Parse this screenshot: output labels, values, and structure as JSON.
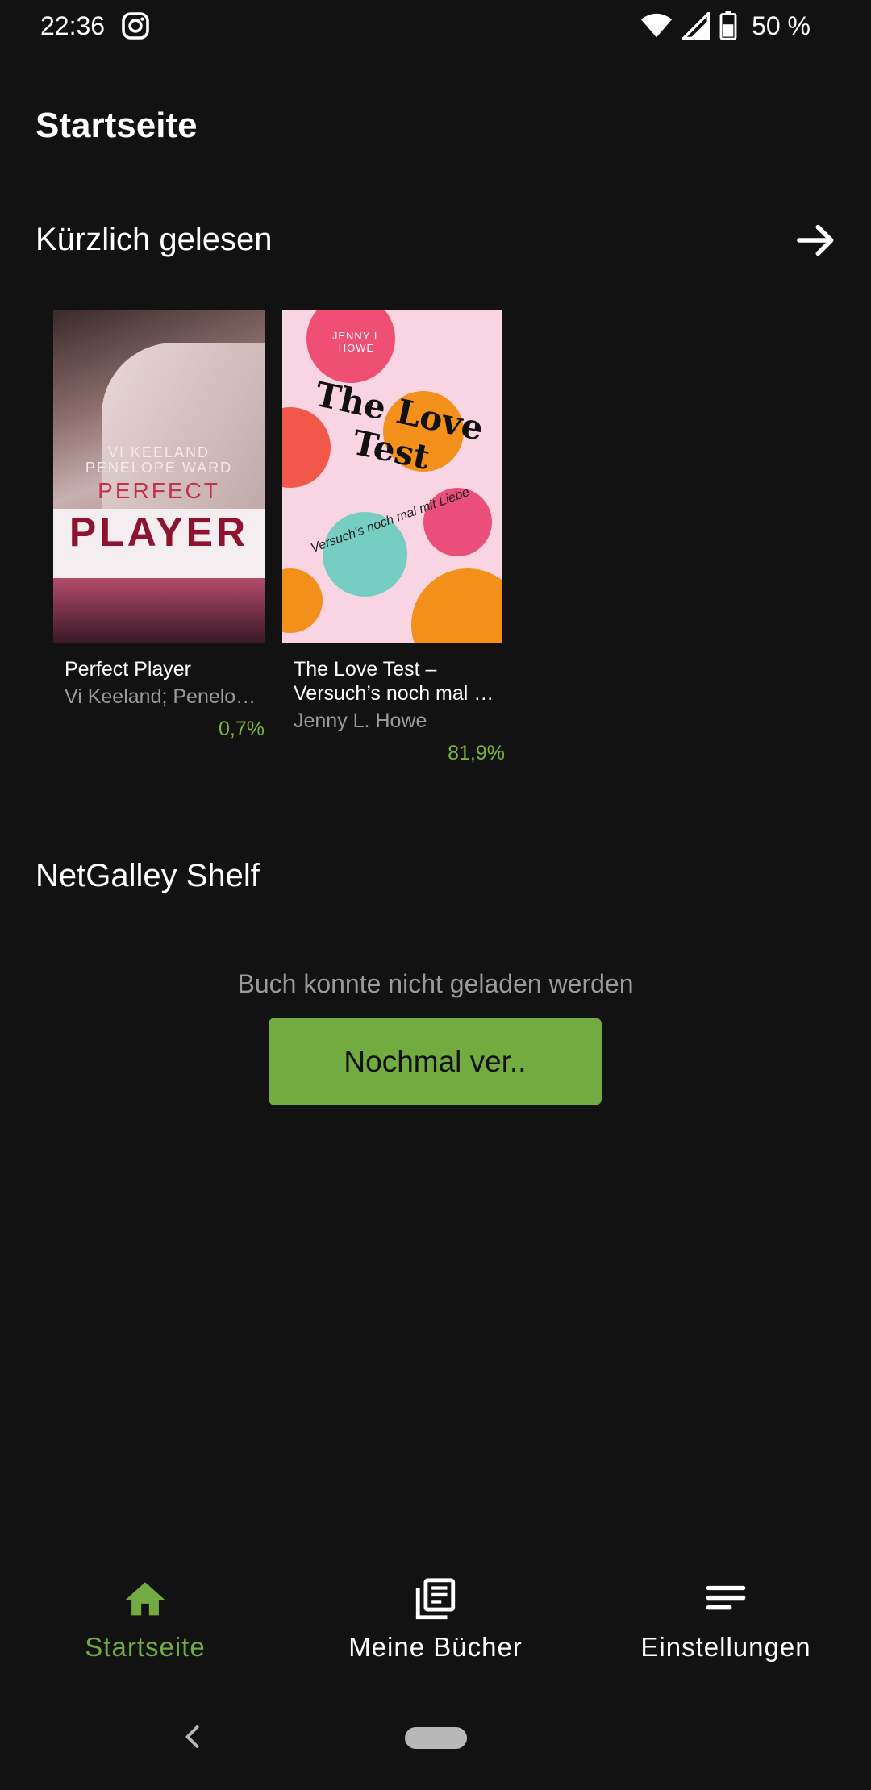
{
  "status_bar": {
    "time": "22:36",
    "battery_percent": "50 %",
    "icons": [
      "instagram-icon",
      "wifi-icon",
      "signal-icon",
      "battery-icon"
    ]
  },
  "header": {
    "title": "Startseite"
  },
  "recent": {
    "title": "Kürzlich gelesen",
    "arrow_icon": "arrow-right-icon",
    "books": [
      {
        "title": "Perfect Player",
        "author": "Vi Keeland; Penelop…",
        "progress": "0,7%",
        "cover": {
          "line1": "VI KEELAND",
          "line2": "PENELOPE WARD",
          "word1": "PERFECT",
          "word2": "PLAYER"
        }
      },
      {
        "title": "The Love Test –\nVersuch’s noch mal …",
        "author": "Jenny L. Howe",
        "progress": "81,9%",
        "cover": {
          "author": "JENNY L HOWE",
          "title": "The Love Test",
          "subtitle": "Versuch's noch mal mit Liebe"
        }
      }
    ]
  },
  "shelf": {
    "title": "NetGalley Shelf",
    "error": "Buch konnte nicht geladen werden",
    "retry_label": "Nochmal ver.."
  },
  "bottom_nav": {
    "items": [
      {
        "label": "Startseite",
        "icon": "home-icon",
        "active": true
      },
      {
        "label": "Meine Bücher",
        "icon": "library-icon",
        "active": false
      },
      {
        "label": "Einstellungen",
        "icon": "menu-lines-icon",
        "active": false
      }
    ]
  },
  "colors": {
    "background": "#121212",
    "accent": "#72ab3f",
    "progress": "#7cb342",
    "muted": "#9a9a9a"
  }
}
